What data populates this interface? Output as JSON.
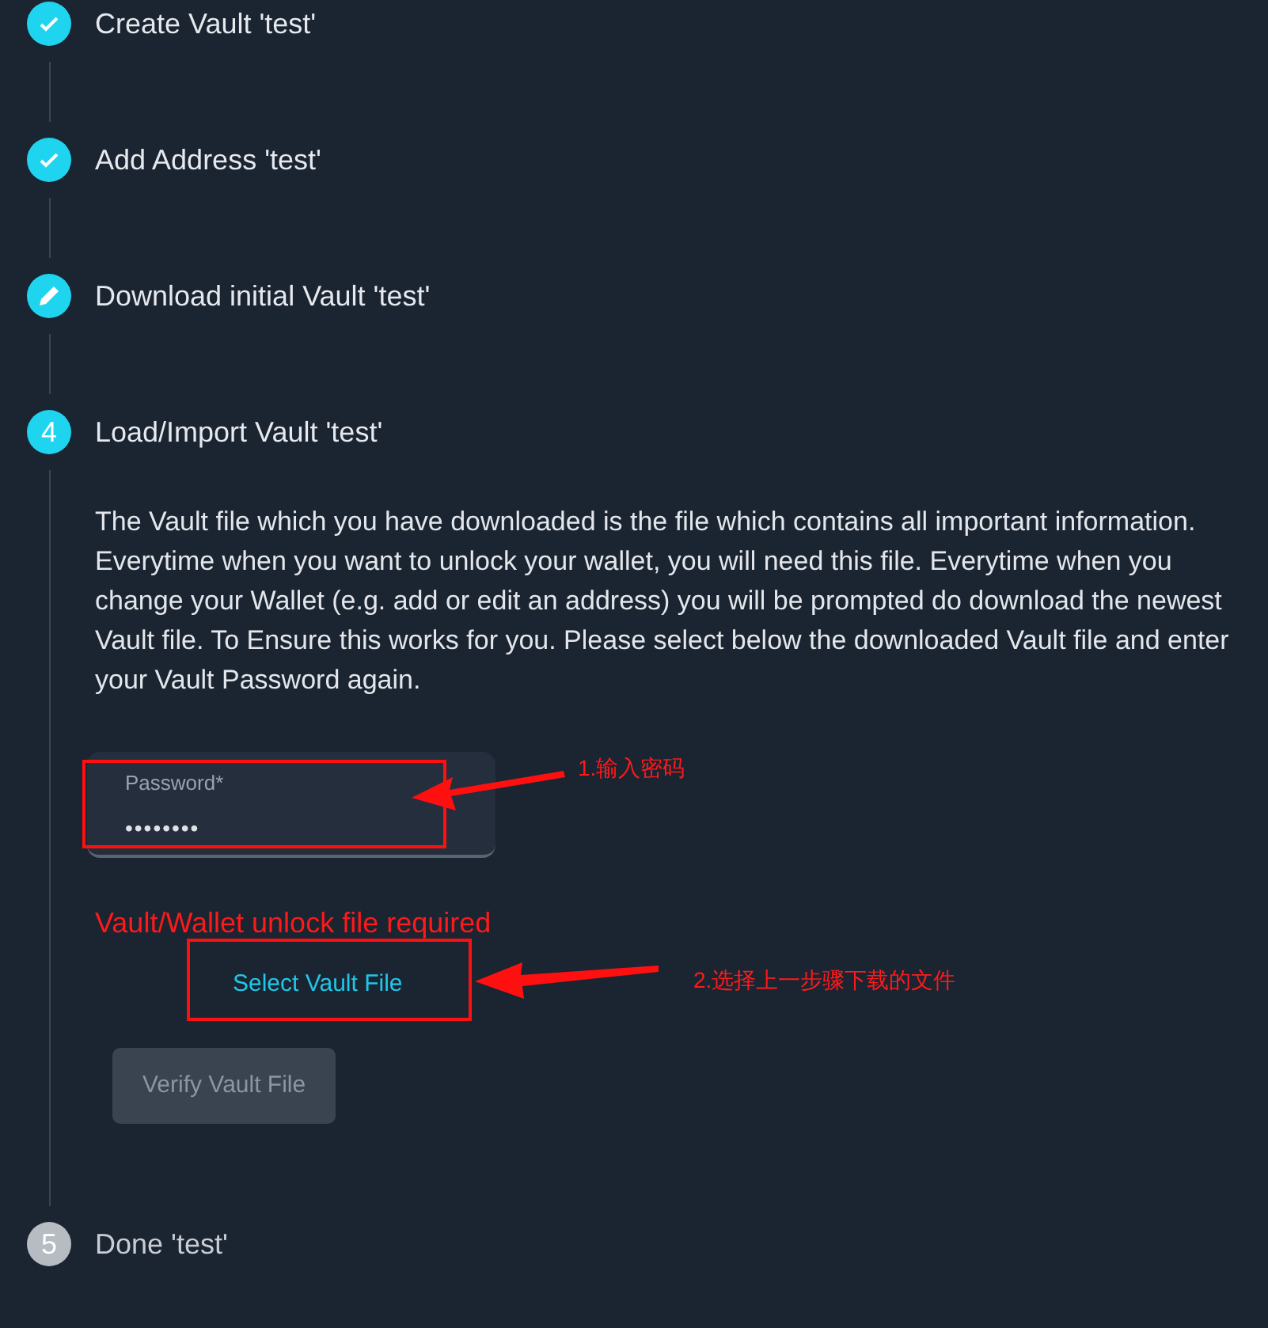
{
  "steps": [
    {
      "kind": "done",
      "title": "Create Vault 'test'"
    },
    {
      "kind": "done",
      "title": "Add Address 'test'"
    },
    {
      "kind": "edit",
      "title": "Download initial Vault 'test'"
    },
    {
      "kind": "current",
      "number": "4",
      "title": "Load/Import Vault 'test'",
      "description": "The Vault file which you have downloaded is the file which contains all important information. Everytime when you want to unlock your wallet, you will need this file. Everytime when you change your Wallet (e.g. add or edit an address) you will be prompted do download the newest Vault file. To Ensure this works for you. Please select below the downloaded Vault file and enter your Vault Password again.",
      "password": {
        "label": "Password*",
        "value": "••••••••"
      },
      "error": "Vault/Wallet unlock file required",
      "select_button": "Select Vault File",
      "verify_button": {
        "label": "Verify Vault File",
        "disabled": true
      }
    },
    {
      "kind": "pending",
      "number": "5",
      "title": "Done 'test'"
    }
  ],
  "annotations": [
    {
      "text": "1.输入密码"
    },
    {
      "text": "2.选择上一步骤下载的文件"
    }
  ]
}
